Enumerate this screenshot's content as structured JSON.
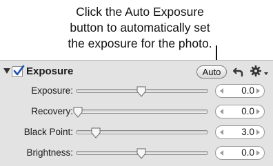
{
  "callout": {
    "lines": [
      "Click the Auto Exposure",
      "button to automatically set",
      "the exposure for the photo."
    ]
  },
  "panel": {
    "title": "Exposure",
    "checked": true,
    "auto_label": "Auto",
    "icons": {
      "disclosure": "disclosure-triangle-icon",
      "reset": "reset-arrow-icon",
      "menu": "gear-menu-icon"
    },
    "rows": [
      {
        "label": "Exposure:",
        "value": "0.0",
        "slider_fraction": 0.5
      },
      {
        "label": "Recovery:",
        "value": "0.0",
        "slider_fraction": 0.0
      },
      {
        "label": "Black Point:",
        "value": "3.0",
        "slider_fraction": 0.15
      },
      {
        "label": "Brightness:",
        "value": "0.0",
        "slider_fraction": 0.5
      }
    ]
  }
}
